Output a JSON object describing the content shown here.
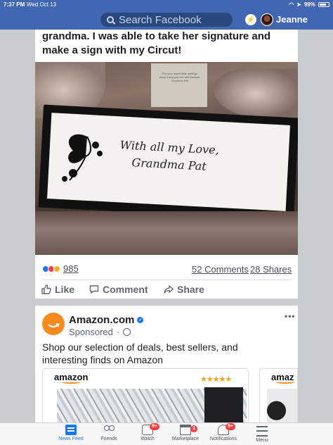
{
  "status_bar": {
    "time": "7:37 PM",
    "date": "Wed Oct 13",
    "battery": "99%"
  },
  "header": {
    "search_placeholder": "Search Facebook",
    "user_name": "Jeanne"
  },
  "post": {
    "text": "grandma. I was able to take her signature and make a sign with my Circut!",
    "photo_signature_line1": "With all my Love,",
    "photo_signature_line2": "Grandma Pat",
    "photo_note_text": "For your sweet little darlings Keep it and you are well blessed, Grandma Pat",
    "reaction_count": "985",
    "comments": "52 Comments",
    "shares": "28 Shares",
    "actions": {
      "like": "Like",
      "comment": "Comment",
      "share": "Share"
    }
  },
  "ad": {
    "advertiser": "Amazon.com",
    "sponsored": "Sponsored",
    "more": "•••",
    "text": "Shop our selection of deals, best sellers, and interesting finds on Amazon",
    "carousel": [
      {
        "brand": "amazon",
        "rating": "★★★★★"
      },
      {
        "brand": "amaz"
      }
    ]
  },
  "tabbar": {
    "items": [
      {
        "label": "News Feed",
        "badge": ""
      },
      {
        "label": "Friends",
        "badge": ""
      },
      {
        "label": "Watch",
        "badge": "9+"
      },
      {
        "label": "Marketplace",
        "badge": "1"
      },
      {
        "label": "Notifications",
        "badge": "9+"
      },
      {
        "label": "Menu",
        "badge": ""
      }
    ]
  },
  "colors": {
    "facebook_blue": "#4267b2",
    "link_blue": "#1877f2",
    "amazon_orange": "#f78a1d",
    "badge_red": "#fa3e3e"
  }
}
